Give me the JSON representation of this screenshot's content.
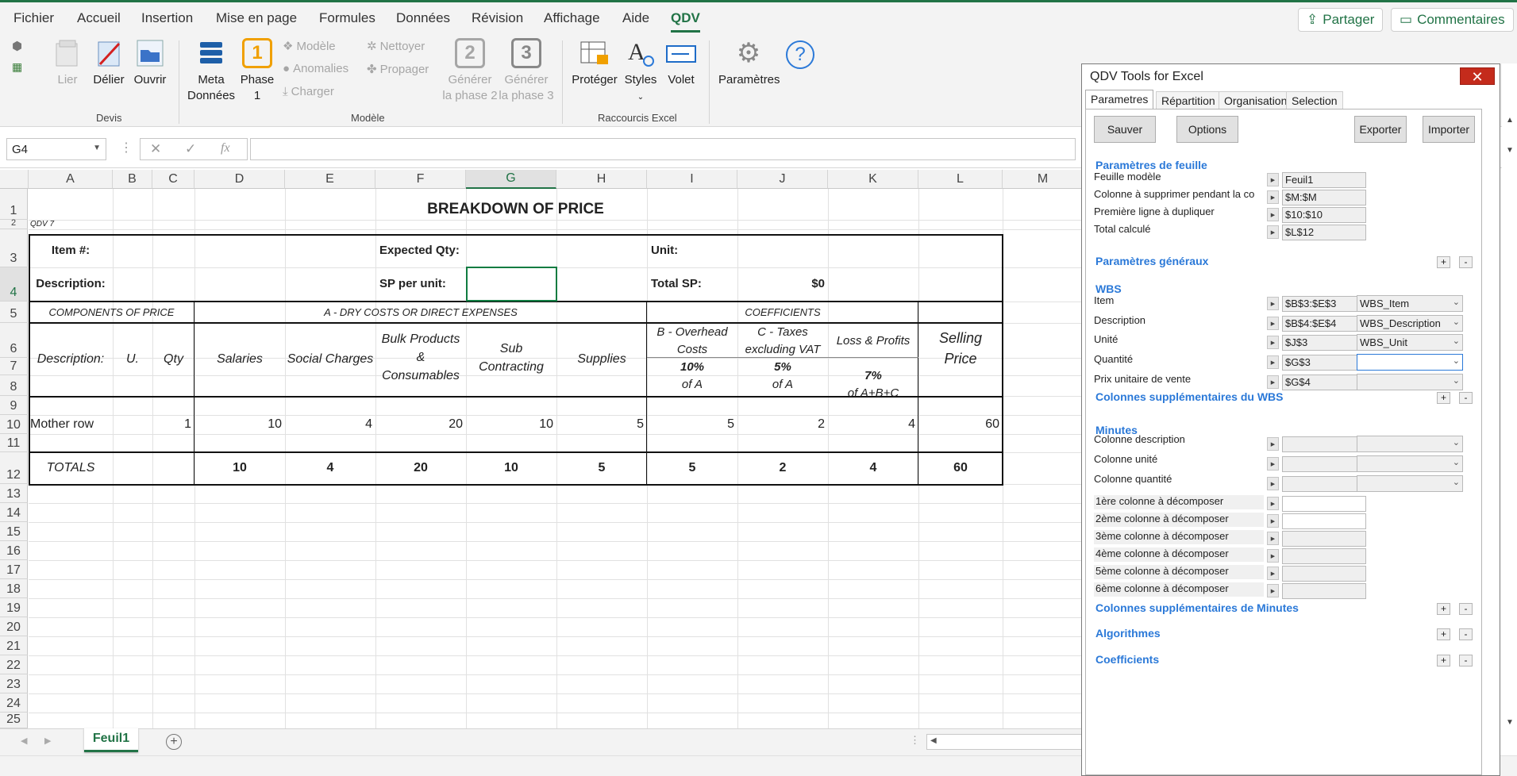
{
  "menu": [
    "Fichier",
    "Accueil",
    "Insertion",
    "Mise en page",
    "Formules",
    "Données",
    "Révision",
    "Affichage",
    "Aide",
    "QDV"
  ],
  "share": "Partager",
  "comments": "Commentaires",
  "ribbon": {
    "lier": "Lier",
    "delier": "Délier",
    "ouvrir": "Ouvrir",
    "meta1": "Meta",
    "meta2": "Données",
    "phase1a": "Phase",
    "phase1b": "1",
    "phase_num": "1",
    "modele": "Modèle",
    "anomalies": "Anomalies",
    "charger": "Charger",
    "nettoyer": "Nettoyer",
    "propager": "Propager",
    "gen2a": "Générer",
    "gen2b": "la phase 2",
    "gen2_num": "2",
    "gen3a": "Générer",
    "gen3b": "la phase 3",
    "gen3_num": "3",
    "proteger": "Protéger",
    "styles": "Styles",
    "volet": "Volet",
    "parametres": "Paramètres",
    "group_devis": "Devis",
    "group_modele": "Modèle",
    "group_raccourcis": "Raccourcis Excel"
  },
  "namebox": "G4",
  "columns": [
    "A",
    "B",
    "C",
    "D",
    "E",
    "F",
    "G",
    "H",
    "I",
    "J",
    "K",
    "L",
    "M"
  ],
  "rows": [
    "1",
    "2",
    "3",
    "4",
    "5",
    "6",
    "7",
    "8",
    "9",
    "10",
    "11",
    "12",
    "13",
    "14",
    "15",
    "16",
    "17",
    "18",
    "19",
    "20",
    "21",
    "22",
    "23",
    "24",
    "25"
  ],
  "sheet": {
    "title": "BREAKDOWN OF PRICE",
    "qdv": "QDV 7",
    "item": "Item #:",
    "expected": "Expected Qty:",
    "unit": "Unit:",
    "description": "Description:",
    "sp_unit": "SP per unit:",
    "total_sp": "Total SP:",
    "total_sp_val": "$0",
    "components": "COMPONENTS OF PRICE",
    "dry": "A - DRY COSTS OR DIRECT EXPENSES",
    "coeff": "COEFFICIENTS",
    "selling1": "Selling",
    "selling2": "Price",
    "h_desc": "Description:",
    "h_u": "U.",
    "h_qty": "Qty",
    "h_sal": "Salaries",
    "h_soc": "Social Charges",
    "h_bulk1": "Bulk Products",
    "h_bulk2": "&",
    "h_bulk3": "Consumables",
    "h_sub1": "Sub",
    "h_sub2": "Contracting",
    "h_sup": "Supplies",
    "h_b1": "B - Overhead",
    "h_b2": "Costs",
    "h_b3": "10%",
    "h_b4": "of A",
    "h_c1": "C - Taxes",
    "h_c2": "excluding VAT",
    "h_c3": "5%",
    "h_c4": "of A",
    "h_l1": "Loss & Profits",
    "h_l3": "7%",
    "h_l4": "of A+B+C",
    "mother": "Mother row",
    "mother_vals": [
      "1",
      "10",
      "4",
      "20",
      "10",
      "5",
      "5",
      "2",
      "4",
      "60"
    ],
    "totals": "TOTALS",
    "totals_vals": [
      "10",
      "4",
      "20",
      "10",
      "5",
      "5",
      "2",
      "4",
      "60"
    ]
  },
  "sheet_tab": "Feuil1",
  "panel": {
    "title": "QDV Tools for Excel",
    "tabs": [
      "Parametres",
      "Répartition",
      "Organisation",
      "Selection"
    ],
    "btn_save": "Sauver",
    "btn_options": "Options",
    "btn_export": "Exporter",
    "btn_import": "Importer",
    "sec_feuille": "Paramètres de feuille",
    "feuille": [
      [
        "Feuille modèle",
        "Feuil1"
      ],
      [
        "Colonne à supprimer pendant la co",
        "$M:$M"
      ],
      [
        "Première ligne à dupliquer",
        "$10:$10"
      ],
      [
        "Total calculé",
        "$L$12"
      ]
    ],
    "sec_generaux": "Paramètres généraux",
    "sec_wbs": "WBS",
    "wbs": [
      [
        "Item",
        "$B$3:$E$3",
        "WBS_Item"
      ],
      [
        "Description",
        "$B$4:$E$4",
        "WBS_Description"
      ],
      [
        "Unité",
        "$J$3",
        "WBS_Unit"
      ],
      [
        "Quantité",
        "$G$3",
        ""
      ],
      [
        "Prix unitaire de vente",
        "$G$4",
        ""
      ]
    ],
    "sec_wbs_extra": "Colonnes supplémentaires du WBS",
    "sec_minutes": "Minutes",
    "minutes": [
      "Colonne description",
      "Colonne unité",
      "Colonne quantité"
    ],
    "decomp": [
      "1ère colonne à décomposer",
      "2ème colonne à décomposer",
      "3ème colonne à décomposer",
      "4ème colonne à décomposer",
      "5ème colonne à décomposer",
      "6ème colonne à décomposer"
    ],
    "sec_min_extra": "Colonnes supplémentaires de Minutes",
    "sec_algo": "Algorithmes",
    "sec_coef": "Coefficients"
  }
}
